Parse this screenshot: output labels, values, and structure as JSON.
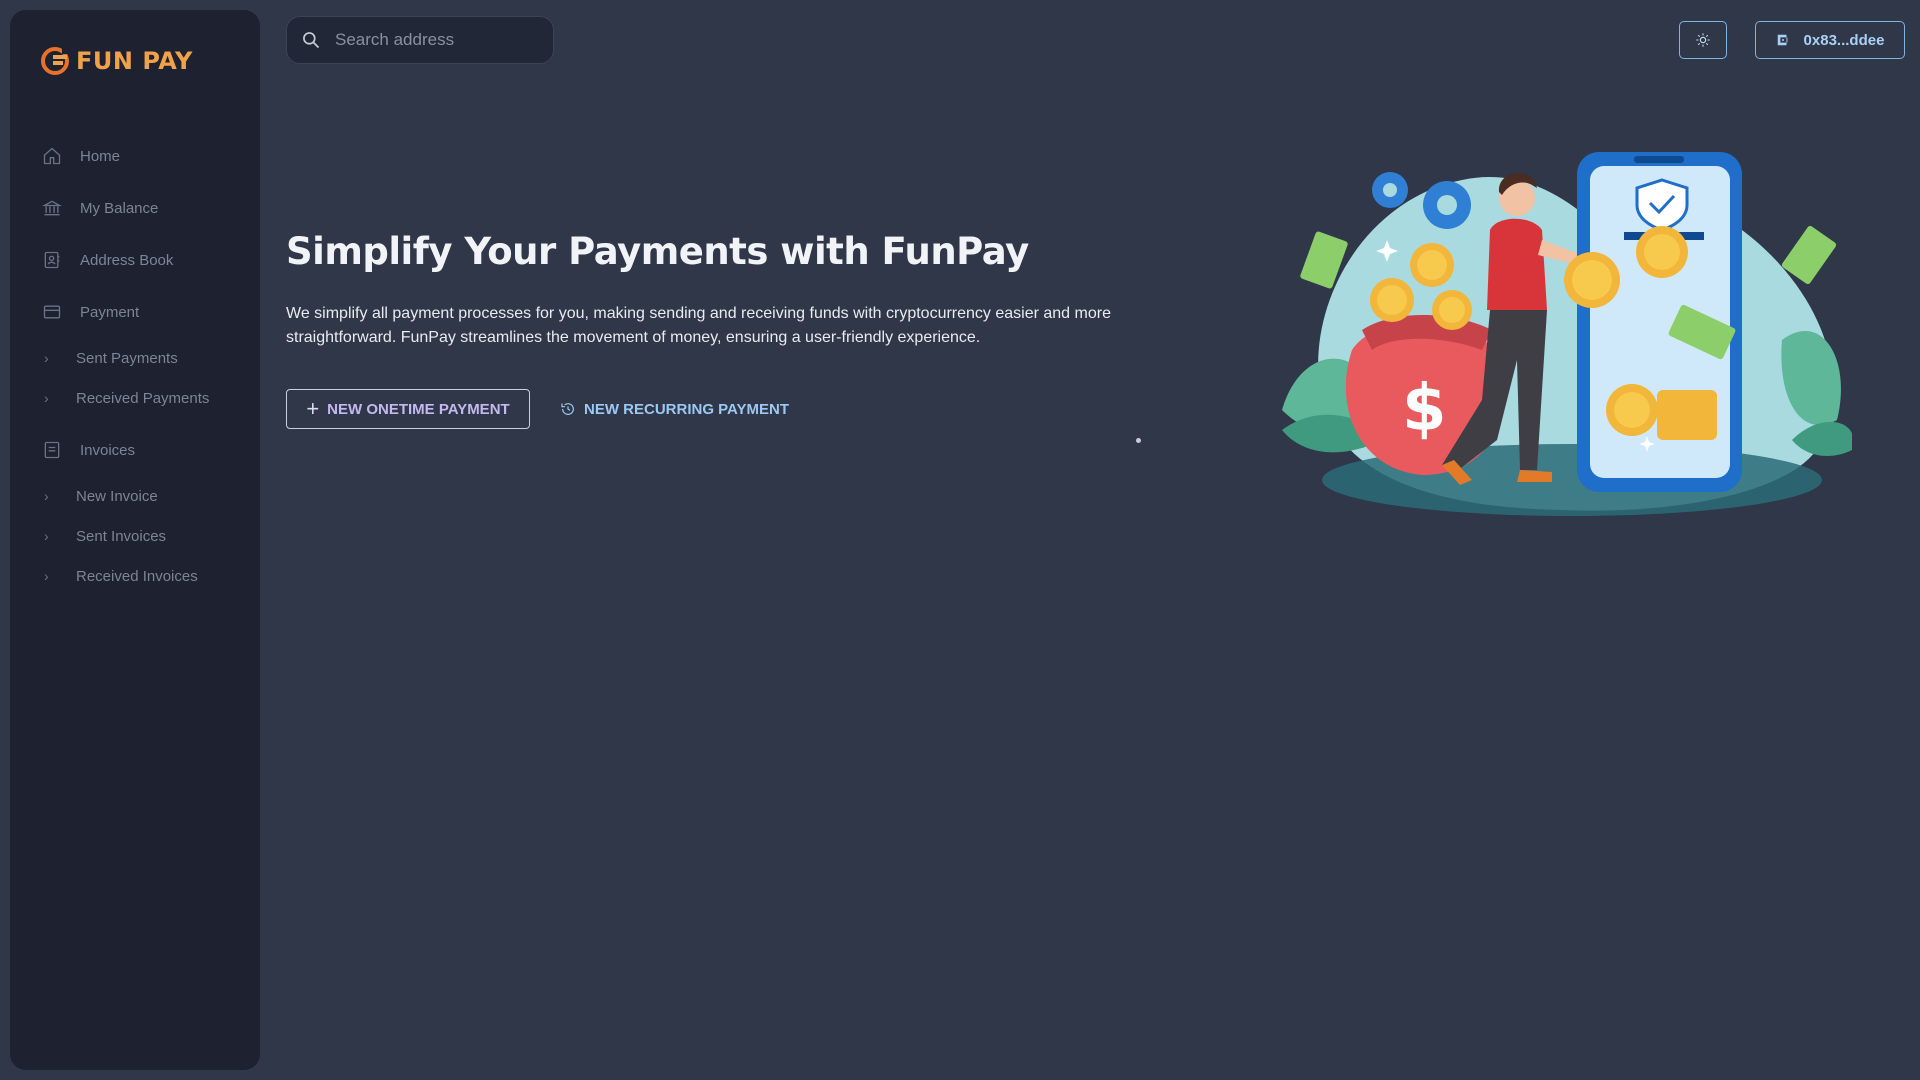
{
  "brand": {
    "name": "FUN PAY"
  },
  "sidebar": {
    "items": [
      {
        "label": "Home",
        "icon": "home-icon"
      },
      {
        "label": "My Balance",
        "icon": "bank-icon"
      },
      {
        "label": "Address Book",
        "icon": "contact-book-icon"
      },
      {
        "label": "Payment",
        "icon": "card-icon"
      },
      {
        "label": "Sent Payments"
      },
      {
        "label": "Received Payments"
      },
      {
        "label": "Invoices",
        "icon": "invoice-icon"
      },
      {
        "label": "New Invoice"
      },
      {
        "label": "Sent Invoices"
      },
      {
        "label": "Received Invoices"
      }
    ]
  },
  "search": {
    "placeholder": "Search address"
  },
  "wallet": {
    "address": "0x83...ddee"
  },
  "hero": {
    "title": "Simplify Your Payments with FunPay",
    "description": "We simplify all payment processes for you, making sending and receiving funds with cryptocurrency easier and more straightforward. FunPay streamlines the movement of money, ensuring a user-friendly experience.",
    "onetime_label": "NEW ONETIME PAYMENT",
    "recurring_label": "NEW RECURRING PAYMENT"
  },
  "colors": {
    "background": "#2f3749",
    "sidebar": "#1d2130",
    "brand_orange": "#f0a14a",
    "accent_blue": "#9cc8f2",
    "accent_purple": "#c5b8f0"
  }
}
